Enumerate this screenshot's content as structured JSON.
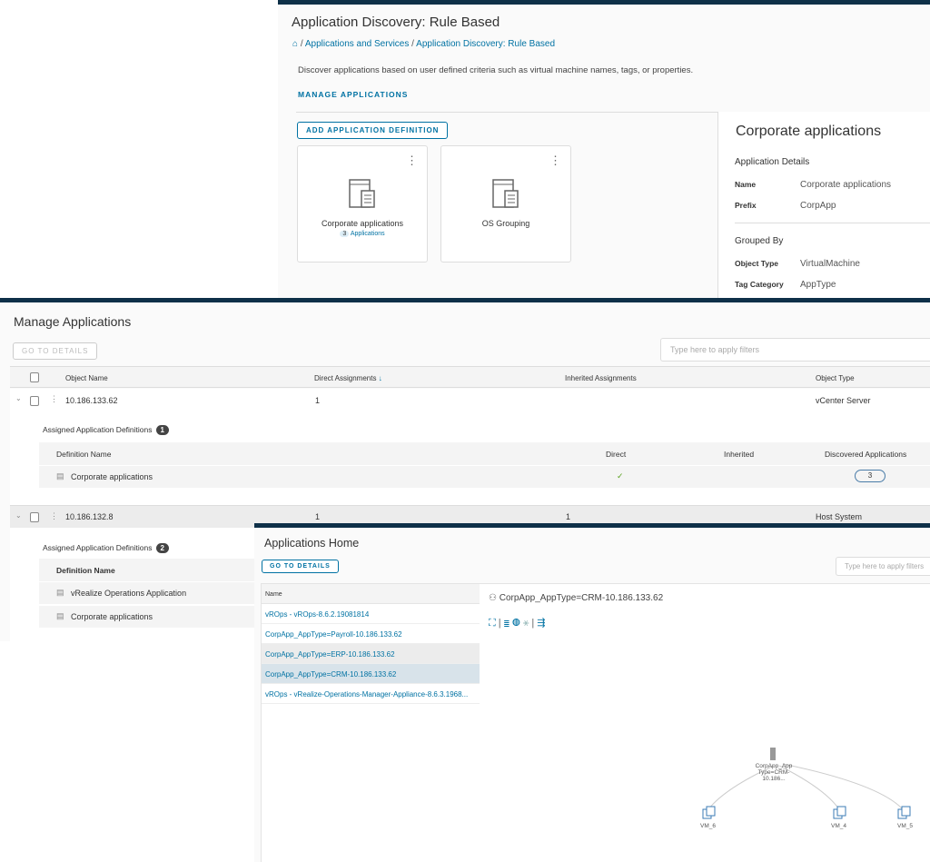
{
  "discovery": {
    "title": "Application Discovery: Rule Based",
    "breadcrumb": [
      "Applications and Services",
      "Application Discovery: Rule Based"
    ],
    "description": "Discover applications based on user defined criteria such as virtual machine names, tags, or properties.",
    "manage_link": "MANAGE APPLICATIONS",
    "add_button": "ADD APPLICATION DEFINITION",
    "cards": [
      {
        "title": "Corporate applications",
        "count": "3",
        "count_label": "Applications"
      },
      {
        "title": "OS Grouping"
      }
    ],
    "details": {
      "title": "Corporate applications",
      "section1": "Application Details",
      "name_label": "Name",
      "name_value": "Corporate applications",
      "prefix_label": "Prefix",
      "prefix_value": "CorpApp",
      "section2": "Grouped By",
      "type_label": "Object Type",
      "type_value": "VirtualMachine",
      "tag_label": "Tag Category",
      "tag_value": "AppType"
    }
  },
  "manage": {
    "title": "Manage Applications",
    "go_button": "GO TO DETAILS",
    "filter_placeholder": "Type here to apply filters",
    "columns": [
      "Object Name",
      "Direct Assignments",
      "Inherited Assignments",
      "Object Type"
    ],
    "rows": [
      {
        "name": "10.186.133.62",
        "direct": "1",
        "inherited": "",
        "type": "vCenter Server",
        "assigned_label": "Assigned Application Definitions",
        "assigned_count": "1",
        "sub_columns": [
          "Definition Name",
          "Direct",
          "Inherited",
          "Discovered Applications"
        ],
        "defs": [
          {
            "name": "Corporate applications",
            "discovered": "3"
          }
        ]
      },
      {
        "name": "10.186.132.8",
        "direct": "1",
        "inherited": "1",
        "type": "Host System",
        "assigned_label": "Assigned Application Definitions",
        "assigned_count": "2",
        "sub_columns": [
          "Definition Name"
        ],
        "defs": [
          {
            "name": "vRealize Operations Application"
          },
          {
            "name": "Corporate applications"
          }
        ]
      }
    ]
  },
  "home": {
    "title": "Applications Home",
    "go_button": "GO TO DETAILS",
    "filter_placeholder": "Type here to apply filters",
    "list_header": "Name",
    "items": [
      "vROps - vROps-8.6.2.19081814",
      "CorpApp_AppType=Payroll-10.186.133.62",
      "CorpApp_AppType=ERP-10.186.133.62",
      "CorpApp_AppType=CRM-10.186.133.62",
      "vROps - vRealize-Operations-Manager-Appliance-8.6.3.1968..."
    ],
    "selected_title": "CorpApp_AppType=CRM-10.186.133.62",
    "graph": {
      "root": "CorpApp_App Type=CRM-10.186...",
      "nodes": [
        "VM_6",
        "VM_4",
        "VM_5"
      ]
    }
  }
}
